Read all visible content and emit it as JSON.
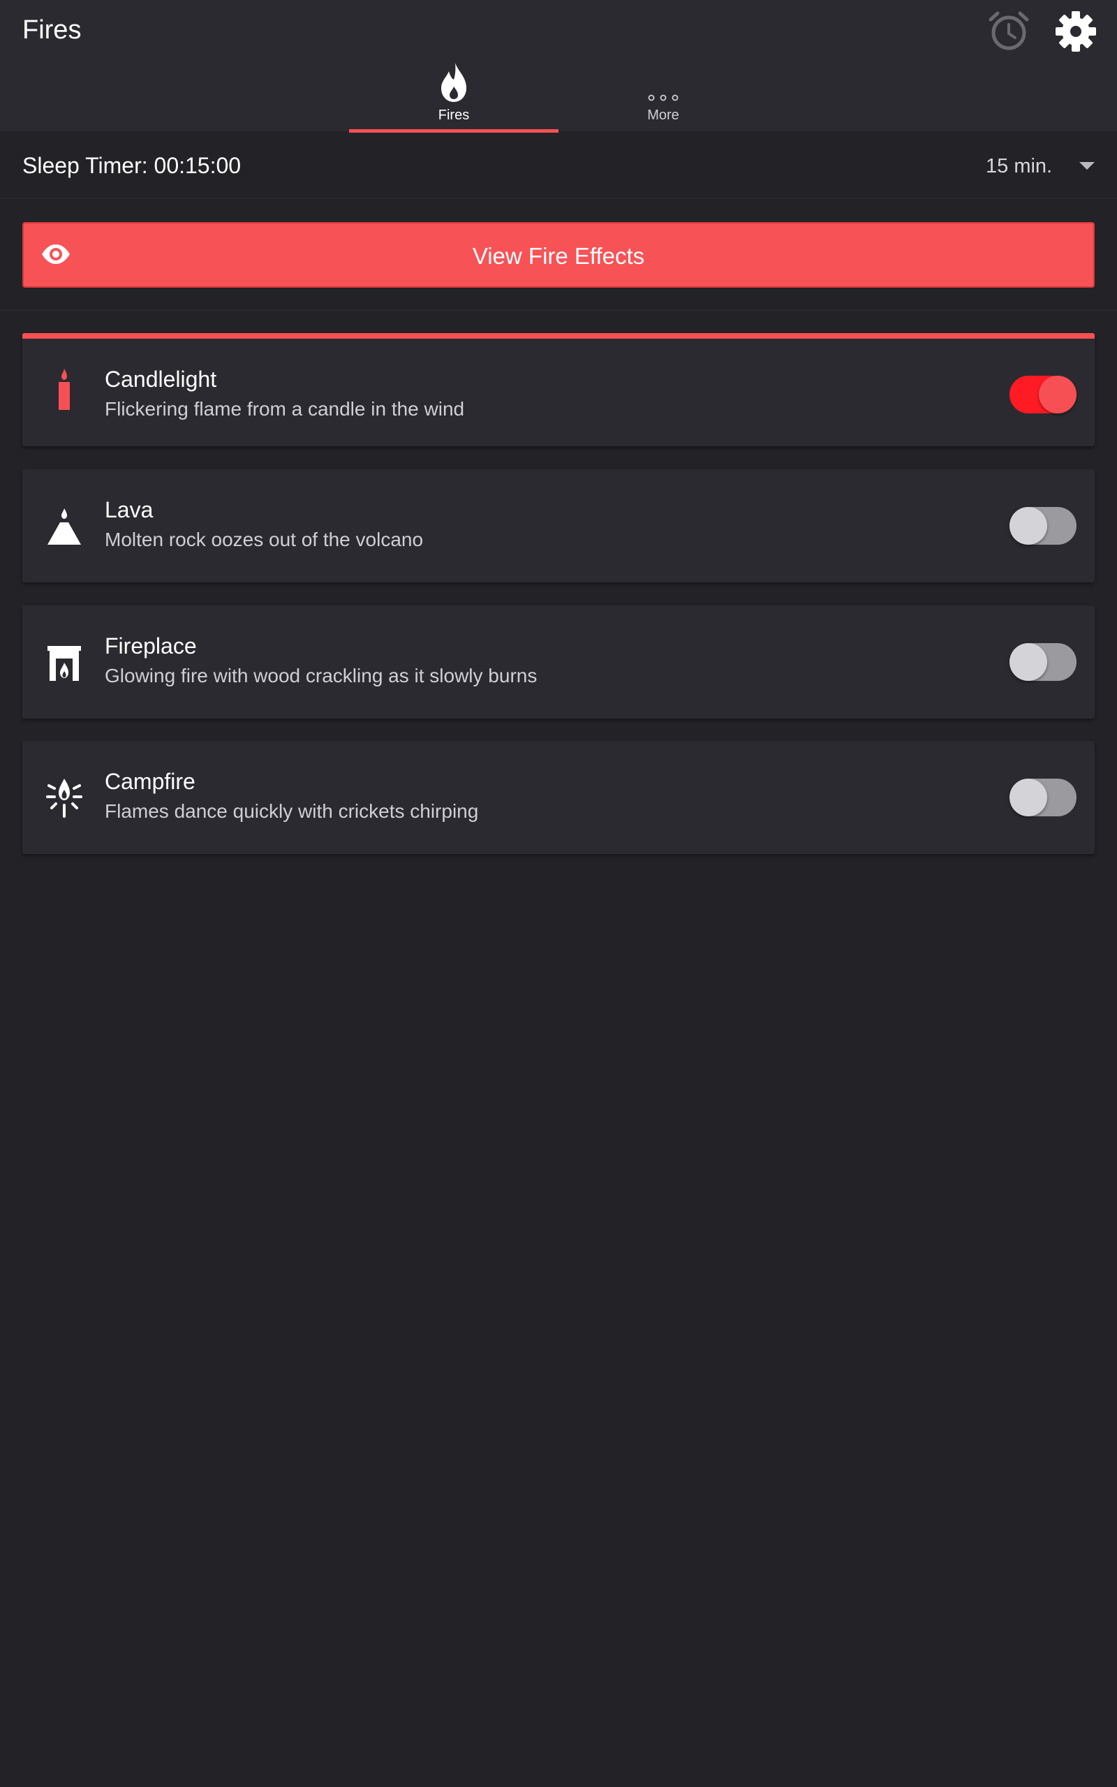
{
  "app": {
    "title": "Fires"
  },
  "header": {
    "alarm_icon": "alarm-clock-icon",
    "settings_icon": "gear-icon"
  },
  "tabs": [
    {
      "label": "Fires",
      "icon": "flame-icon",
      "selected": true
    },
    {
      "label": "More",
      "icon": "more-dots-icon",
      "selected": false
    }
  ],
  "sleep_timer": {
    "label": "Sleep Timer: 00:15:00",
    "selected_value": "15 min."
  },
  "effects_button": {
    "label": "View Fire Effects",
    "icon": "eye-icon"
  },
  "fires": [
    {
      "name": "Candlelight",
      "description": "Flickering flame from a candle in the wind",
      "icon": "candle-icon",
      "enabled": true
    },
    {
      "name": "Lava",
      "description": "Molten rock oozes out of the volcano",
      "icon": "volcano-icon",
      "enabled": false
    },
    {
      "name": "Fireplace",
      "description": "Glowing fire with wood crackling as it slowly burns",
      "icon": "fireplace-icon",
      "enabled": false
    },
    {
      "name": "Campfire",
      "description": "Flames dance quickly with crickets chirping",
      "icon": "campfire-icon",
      "enabled": false
    }
  ],
  "colors": {
    "accent": "#f75054",
    "background": "#232227",
    "card": "#2b2a30",
    "toggle_on": "#ff1b24"
  }
}
